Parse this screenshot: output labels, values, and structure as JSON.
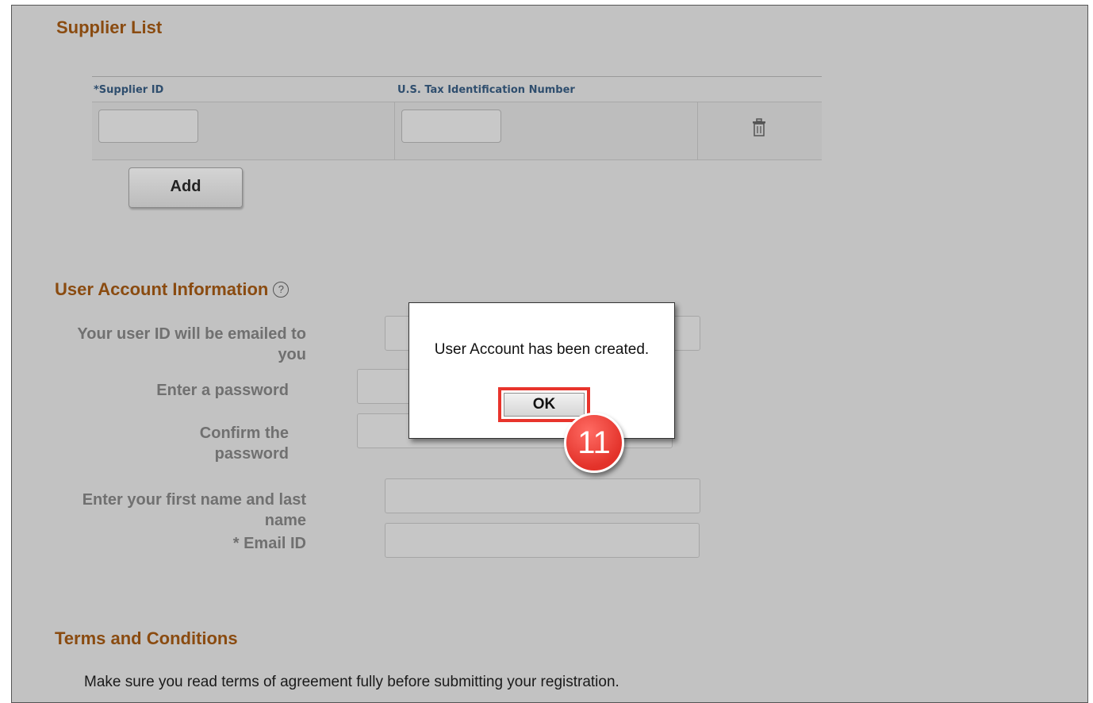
{
  "supplier_list": {
    "title": "Supplier List",
    "col_supplier_id": "*Supplier ID",
    "col_tax_id": "U.S. Tax Identification Number",
    "add_label": "Add",
    "supplier_id_value": "",
    "tax_id_value": ""
  },
  "user_account": {
    "title": "User Account Information",
    "help_icon": "?",
    "user_id_label_1": "Your user ID will be emailed to",
    "user_id_label_2": "you",
    "password_label": "Enter a password",
    "confirm_label_1": "Confirm the",
    "confirm_label_2": "password",
    "name_label_1": "Enter your first name and last",
    "name_label_2": "name",
    "email_label": "* Email ID"
  },
  "terms": {
    "title": "Terms and Conditions",
    "text": "Make sure you read terms of agreement fully before submitting your registration."
  },
  "dialog": {
    "message": "User Account has been created.",
    "ok_label": "OK"
  },
  "step_badge": "11",
  "colors": {
    "accent_title": "#8a4b10",
    "highlight": "#e8342c",
    "overlay_bg": "#c2c2c2"
  }
}
